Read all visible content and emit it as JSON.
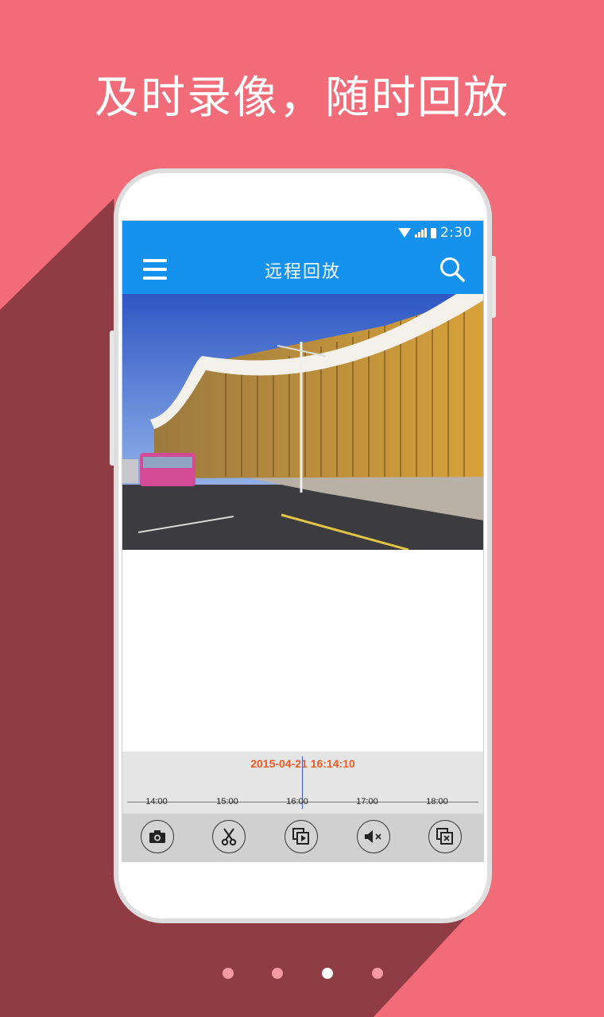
{
  "headline": "及时录像，随时回放",
  "status_bar": {
    "time": "2:30",
    "icons": [
      "wifi-icon",
      "signal-icon",
      "battery-icon"
    ]
  },
  "app_bar": {
    "title": "远程回放",
    "menu_icon": "menu-icon",
    "search_icon": "search-icon"
  },
  "video": {
    "description_icon": "video-frame"
  },
  "timeline": {
    "current_time": "2015-04-21 16:14:10",
    "ticks": [
      "14:00",
      "15:00",
      "16:00",
      "17:00",
      "18:00"
    ]
  },
  "toolbar": {
    "buttons": [
      "camera-icon",
      "scissors-icon",
      "playback-icon",
      "mute-icon",
      "close-window-icon"
    ]
  },
  "pager": {
    "count": 4,
    "active_index": 2
  },
  "colors": {
    "background": "#f26b78",
    "accent": "#1591ee",
    "timestamp": "#ef5a24"
  }
}
